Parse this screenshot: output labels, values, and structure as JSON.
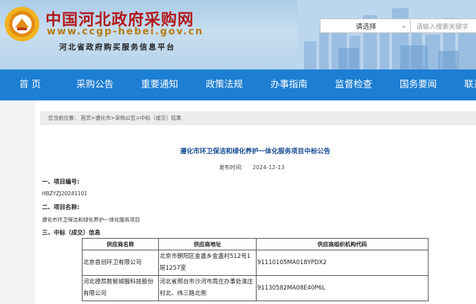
{
  "header": {
    "site_title": "中国河北政府采购网",
    "site_url": "www.ccgp-hebei.gov.cn",
    "site_subtitle": "河北省政府购买服务信息平台",
    "logo_icon": "procurement-emblem-icon",
    "search": {
      "select_value": "请选择",
      "input_placeholder": "请输入搜索关键字"
    }
  },
  "nav": {
    "items": [
      "首 页",
      "采购公告",
      "重要通知",
      "政策法规",
      "办事指南",
      "监督检查",
      "国务要闻",
      "联系"
    ]
  },
  "breadcrumb": {
    "label": "您当前位置:",
    "items": [
      "首页",
      "遵化市",
      "采购公告",
      "中标（成交）结果"
    ],
    "separator": ">"
  },
  "article": {
    "title": "遵化市环卫保洁和绿化养护一体化服务项目中标公告",
    "pub_label": "发布时间:",
    "pub_date": "2024-12-13",
    "section1_heading": "一、项目编号:",
    "section1_value": "HBZYZJ20241101",
    "section2_heading": "二、项目名称:",
    "section2_value": "遵化市环卫保洁和绿化养护一体化服务项目",
    "section3_heading": "三、中标（成交）信息"
  },
  "table": {
    "headers": [
      "供应商名称",
      "供应商地址",
      "供应商组织机构代码"
    ],
    "rows": [
      [
        "北京首创环卫有限公司",
        "北京市朝阳区金盏乡金盏村512号1层1257室",
        "91110105MA018YPDX2"
      ],
      [
        "河北德昂数智城服科技股份有限公司",
        "河北省邢台市沙河市周庄办事处淮庄村北、纬三路北侧",
        "91130582MA08E40P6L"
      ]
    ]
  },
  "colors": {
    "nav_bg": "#1d7ed3",
    "title_red": "#b3181b",
    "url_gold": "#b57a12",
    "article_title_blue": "#1a4e96"
  }
}
